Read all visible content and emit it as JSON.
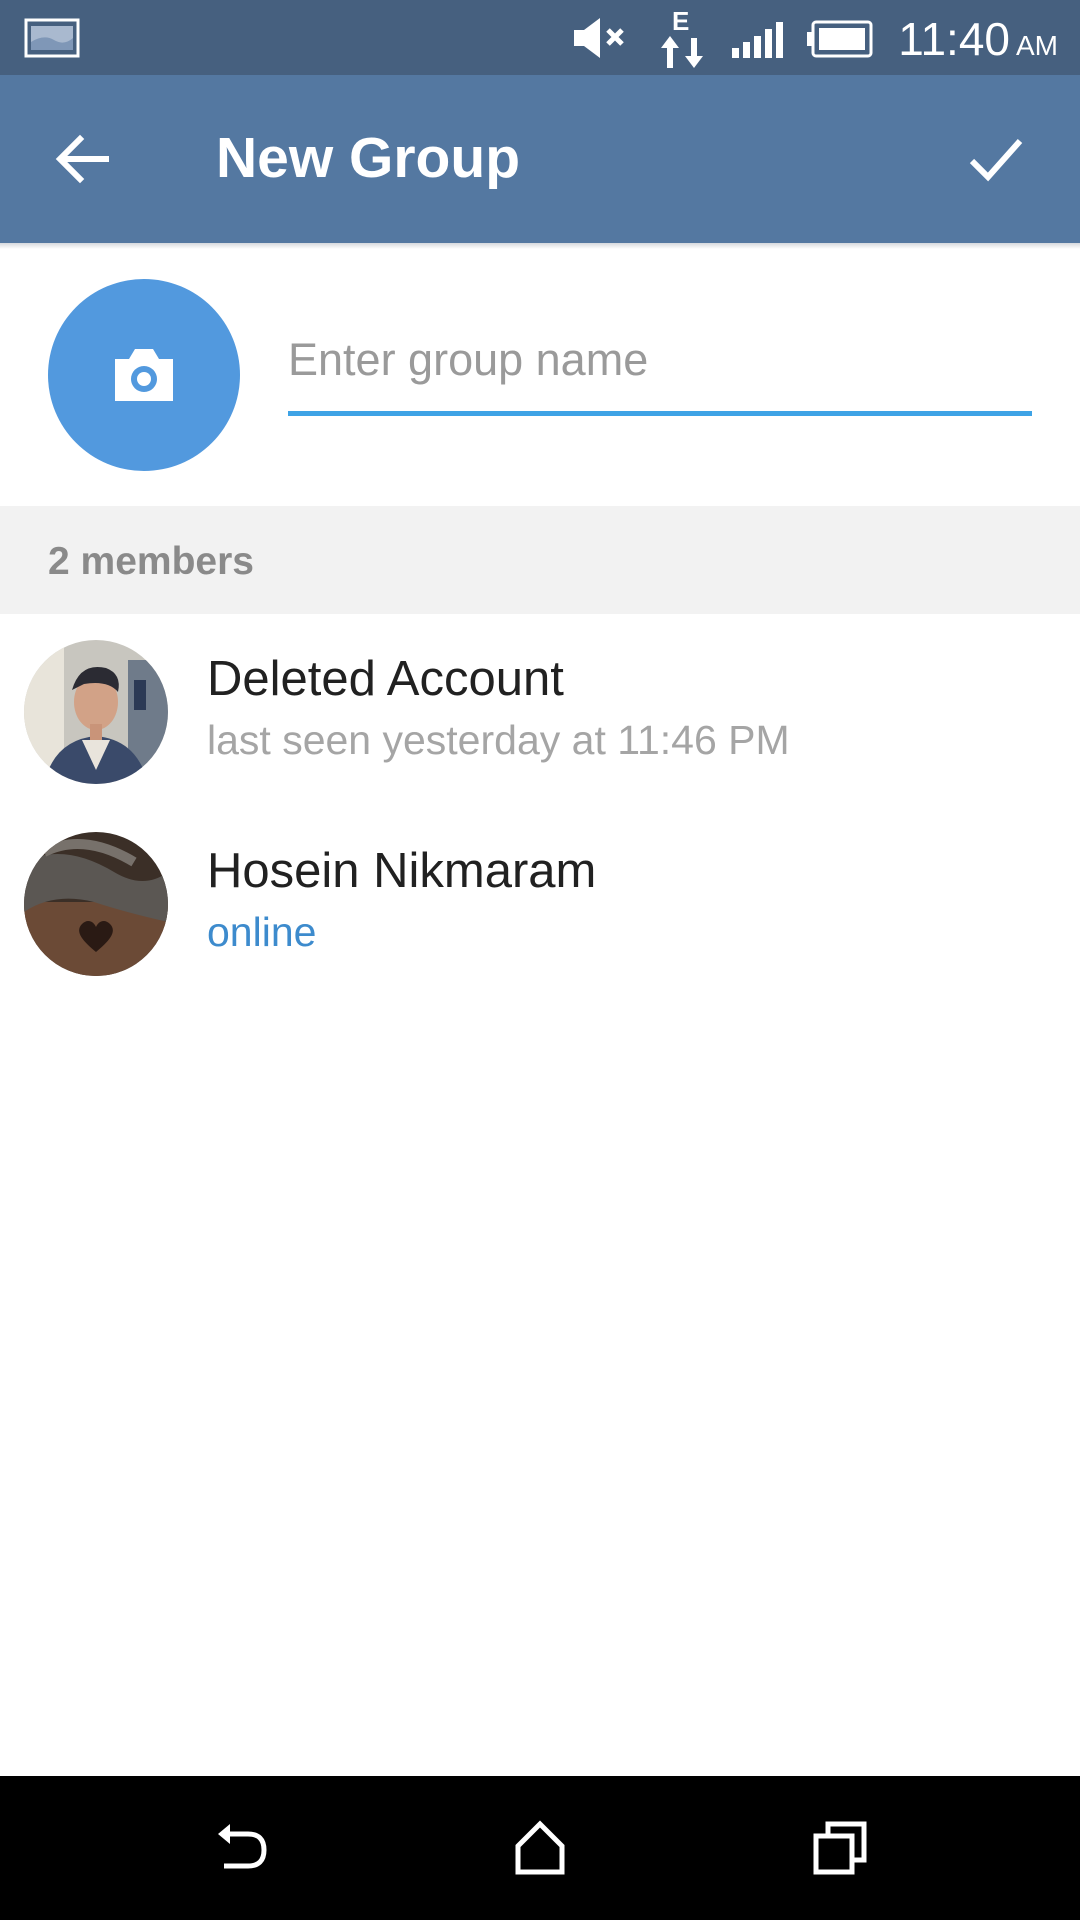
{
  "status_bar": {
    "time": "11:40",
    "ampm": "AM",
    "icons": [
      "gallery-icon",
      "mute-icon",
      "edge-data-icon",
      "signal-icon",
      "battery-icon"
    ],
    "network_label": "E"
  },
  "app_bar": {
    "title": "New Group",
    "back_icon": "arrow-left-icon",
    "confirm_icon": "check-icon",
    "color": "#5478a1"
  },
  "group_form": {
    "photo_icon": "camera-icon",
    "name_placeholder": "Enter group name",
    "name_value": "",
    "accent": "#3ea3e6"
  },
  "members": {
    "header": "2 members",
    "items": [
      {
        "name": "Deleted Account",
        "status": "last seen yesterday at 11:46 PM",
        "online": false
      },
      {
        "name": "Hosein Nikmaram",
        "status": "online",
        "online": true
      }
    ]
  },
  "nav_bar": {
    "icons": [
      "back-nav-icon",
      "home-icon",
      "recents-icon"
    ]
  }
}
